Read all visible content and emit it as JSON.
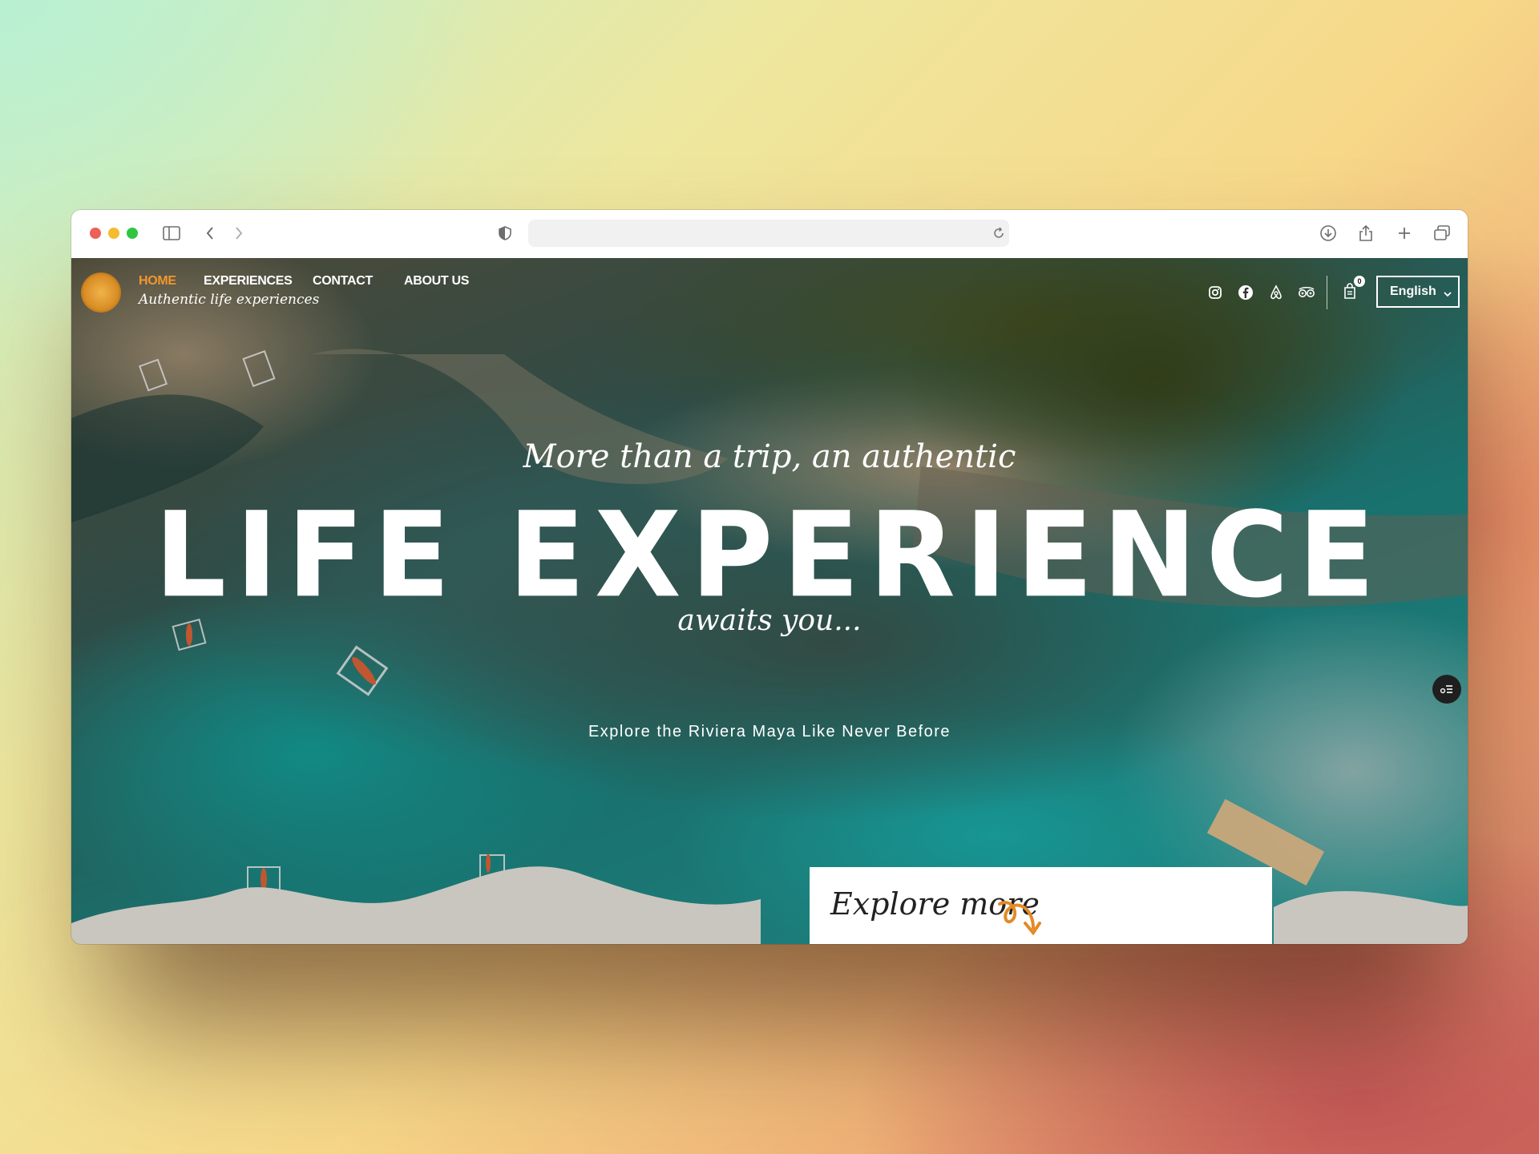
{
  "browser": {
    "url": "",
    "traffic_lights": [
      "#ee5f57",
      "#f5bc2f",
      "#31c640"
    ]
  },
  "site": {
    "logo": "jaguar-logo",
    "tagline": "Authentic life experiences",
    "nav": [
      {
        "label": "HOME",
        "active": true
      },
      {
        "label": "EXPERIENCES",
        "active": false
      },
      {
        "label": "CONTACT",
        "active": false
      },
      {
        "label": "ABOUT US",
        "active": false
      }
    ],
    "social_icons": [
      "instagram-icon",
      "facebook-icon",
      "airbnb-icon",
      "tripadvisor-icon"
    ],
    "cart_count": "0",
    "language": "English",
    "accent_color": "#f2962e"
  },
  "hero": {
    "script_top": "More than a trip, an authentic",
    "title": "LIFE EXPERIENCE",
    "script_bottom": "awaits you...",
    "subtitle": "Explore the Riviera Maya Like Never Before"
  },
  "explore": {
    "label": "Explore more"
  }
}
